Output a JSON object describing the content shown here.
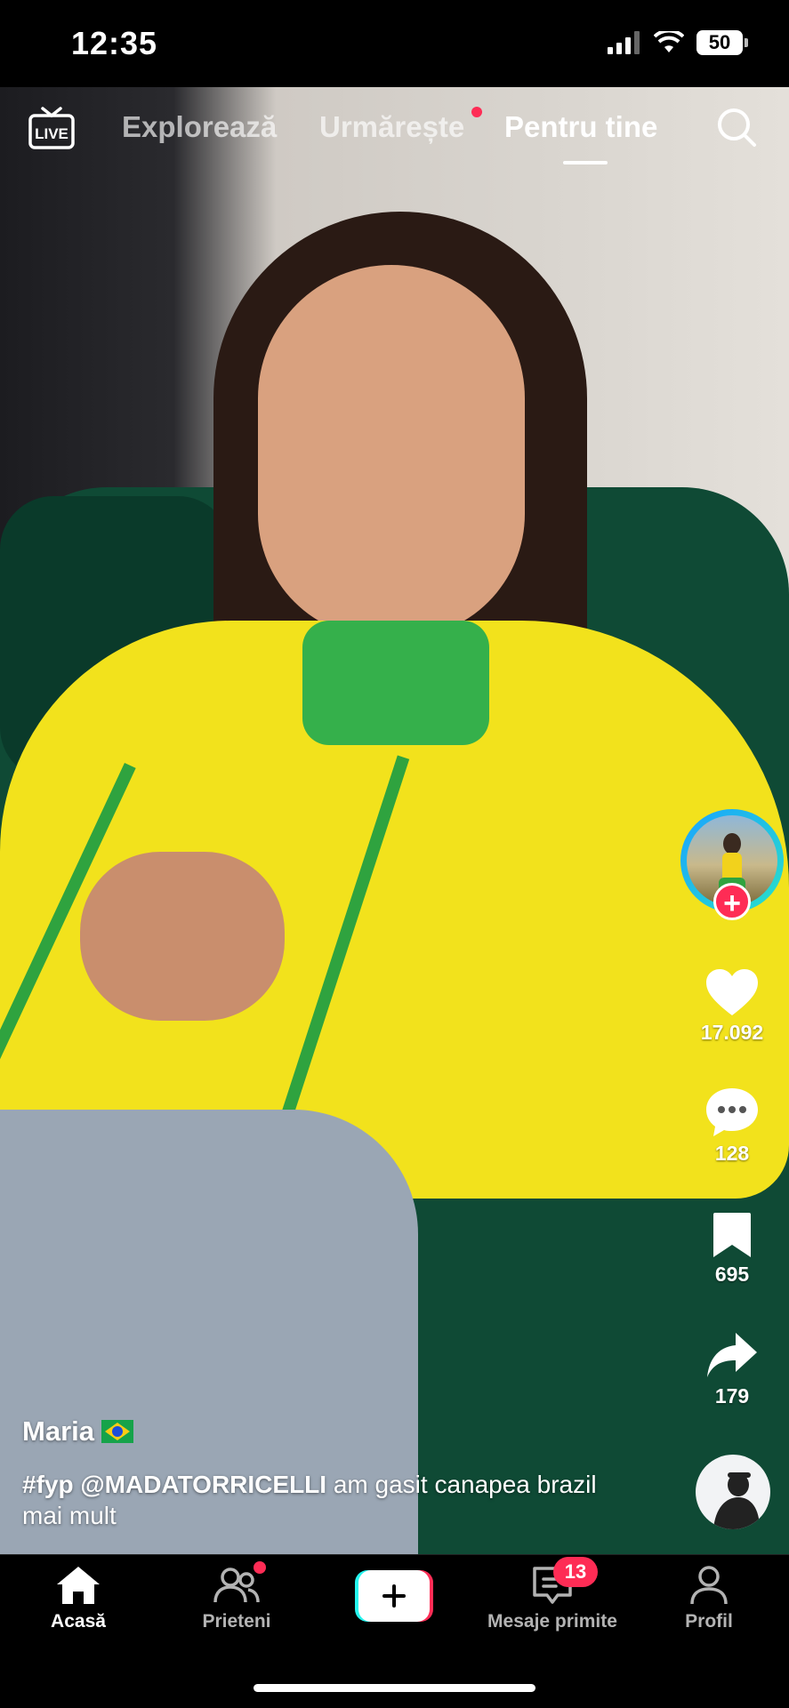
{
  "status": {
    "time": "12:35",
    "battery": "50"
  },
  "top_nav": {
    "live_label": "LIVE",
    "tabs": [
      {
        "label": "Explorează",
        "active": false
      },
      {
        "label": "Urmărește",
        "active": false,
        "dot": true
      },
      {
        "label": "Pentru tine",
        "active": true
      }
    ]
  },
  "actions": {
    "likes": "17.092",
    "comments": "128",
    "saves": "695",
    "shares": "179"
  },
  "caption": {
    "username": "Maria",
    "hashtag": "#fyp",
    "mention": "@MADATORRICELLI",
    "text": "am gasit canapea brazil mai mult"
  },
  "bottom_nav": {
    "items": [
      {
        "label": "Acasă",
        "active": true
      },
      {
        "label": "Prieteni",
        "active": false
      },
      {
        "label": "Mesaje primite",
        "active": false,
        "badge": "13"
      },
      {
        "label": "Profil",
        "active": false
      }
    ]
  },
  "colors": {
    "accent": "#fe2c55",
    "background": "#000000",
    "ring": "#1aa3ff"
  },
  "icons": [
    "live-icon",
    "search-icon",
    "heart-icon",
    "comment-icon",
    "bookmark-icon",
    "share-icon",
    "home-icon",
    "friends-icon",
    "create-icon",
    "inbox-icon",
    "profile-icon"
  ]
}
